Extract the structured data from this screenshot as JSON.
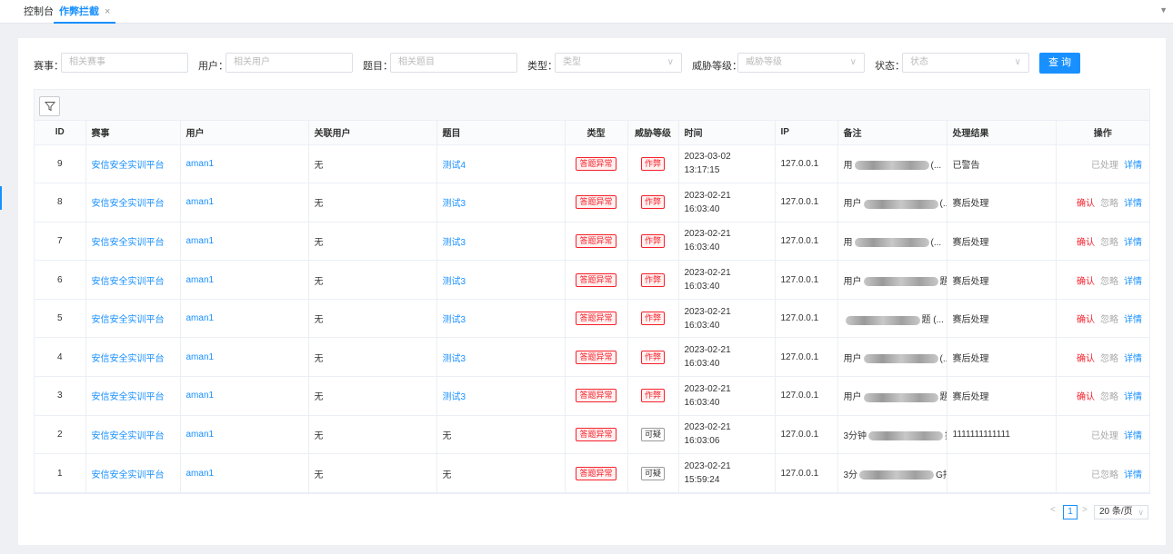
{
  "tabs": {
    "console": "控制台",
    "active": "作弊拦截",
    "close": "×",
    "dropdown": "▼"
  },
  "filters": {
    "event_label": "赛事：",
    "event_placeholder": "相关赛事",
    "user_label": "用户：",
    "user_placeholder": "相关用户",
    "problem_label": "题目：",
    "problem_placeholder": "相关题目",
    "type_label": "类型：",
    "type_placeholder": "类型",
    "threat_label": "威胁等级：",
    "threat_placeholder": "威胁等级",
    "status_label": "状态：",
    "status_placeholder": "状态",
    "query_button": "查 询"
  },
  "table": {
    "headers": {
      "id": "ID",
      "event": "赛事",
      "user": "用户",
      "related_user": "关联用户",
      "problem": "题目",
      "type": "类型",
      "threat": "威胁等级",
      "time": "时间",
      "ip": "IP",
      "remark": "备注",
      "result": "处理结果",
      "ops": "操作"
    },
    "rows": [
      {
        "id": "9",
        "event": "安信安全实训平台",
        "user": "aman1",
        "related": "无",
        "problem": "测试4",
        "problem_link": true,
        "type": "答题异常",
        "threat": "作弊",
        "threat_style": "red",
        "date": "2023-03-02",
        "clock": "13:17:15",
        "ip": "127.0.0.1",
        "remark_pre": "用",
        "remark_post": "(...",
        "result": "已警告",
        "ops": [
          {
            "label": "已处理",
            "style": "gray"
          },
          {
            "label": "详情",
            "style": "blue"
          }
        ]
      },
      {
        "id": "8",
        "event": "安信安全实训平台",
        "user": "aman1",
        "related": "无",
        "problem": "测试3",
        "problem_link": true,
        "type": "答题异常",
        "threat": "作弊",
        "threat_style": "red",
        "date": "2023-02-21",
        "clock": "16:03:40",
        "ip": "127.0.0.1",
        "remark_pre": "用户",
        "remark_post": "(...",
        "result": "赛后处理",
        "ops": [
          {
            "label": "确认",
            "style": "red"
          },
          {
            "label": "忽略",
            "style": "gray"
          },
          {
            "label": "详情",
            "style": "blue"
          }
        ]
      },
      {
        "id": "7",
        "event": "安信安全实训平台",
        "user": "aman1",
        "related": "无",
        "problem": "测试3",
        "problem_link": true,
        "type": "答题异常",
        "threat": "作弊",
        "threat_style": "red",
        "date": "2023-02-21",
        "clock": "16:03:40",
        "ip": "127.0.0.1",
        "remark_pre": "用",
        "remark_post": "(...",
        "result": "赛后处理",
        "ops": [
          {
            "label": "确认",
            "style": "red"
          },
          {
            "label": "忽略",
            "style": "gray"
          },
          {
            "label": "详情",
            "style": "blue"
          }
        ]
      },
      {
        "id": "6",
        "event": "安信安全实训平台",
        "user": "aman1",
        "related": "无",
        "problem": "测试3",
        "problem_link": true,
        "type": "答题异常",
        "threat": "作弊",
        "threat_style": "red",
        "date": "2023-02-21",
        "clock": "16:03:40",
        "ip": "127.0.0.1",
        "remark_pre": "用户",
        "remark_post": "题 (...",
        "result": "赛后处理",
        "ops": [
          {
            "label": "确认",
            "style": "red"
          },
          {
            "label": "忽略",
            "style": "gray"
          },
          {
            "label": "详情",
            "style": "blue"
          }
        ]
      },
      {
        "id": "5",
        "event": "安信安全实训平台",
        "user": "aman1",
        "related": "无",
        "problem": "测试3",
        "problem_link": true,
        "type": "答题异常",
        "threat": "作弊",
        "threat_style": "red",
        "date": "2023-02-21",
        "clock": "16:03:40",
        "ip": "127.0.0.1",
        "remark_pre": "",
        "remark_post": "题 (...",
        "result": "赛后处理",
        "ops": [
          {
            "label": "确认",
            "style": "red"
          },
          {
            "label": "忽略",
            "style": "gray"
          },
          {
            "label": "详情",
            "style": "blue"
          }
        ]
      },
      {
        "id": "4",
        "event": "安信安全实训平台",
        "user": "aman1",
        "related": "无",
        "problem": "测试3",
        "problem_link": true,
        "type": "答题异常",
        "threat": "作弊",
        "threat_style": "red",
        "date": "2023-02-21",
        "clock": "16:03:40",
        "ip": "127.0.0.1",
        "remark_pre": "用户",
        "remark_post": "(...",
        "result": "赛后处理",
        "ops": [
          {
            "label": "确认",
            "style": "red"
          },
          {
            "label": "忽略",
            "style": "gray"
          },
          {
            "label": "详情",
            "style": "blue"
          }
        ]
      },
      {
        "id": "3",
        "event": "安信安全实训平台",
        "user": "aman1",
        "related": "无",
        "problem": "测试3",
        "problem_link": true,
        "type": "答题异常",
        "threat": "作弊",
        "threat_style": "red",
        "date": "2023-02-21",
        "clock": "16:03:40",
        "ip": "127.0.0.1",
        "remark_pre": "用户",
        "remark_post": "题 (...",
        "result": "赛后处理",
        "ops": [
          {
            "label": "确认",
            "style": "red"
          },
          {
            "label": "忽略",
            "style": "gray"
          },
          {
            "label": "详情",
            "style": "blue"
          }
        ]
      },
      {
        "id": "2",
        "event": "安信安全实训平台",
        "user": "aman1",
        "related": "无",
        "problem": "无",
        "problem_link": false,
        "type": "答题异常",
        "threat": "可疑",
        "threat_style": "dark",
        "date": "2023-02-21",
        "clock": "16:03:06",
        "ip": "127.0.0.1",
        "remark_pre": "3分钟",
        "remark_post": "提交错...",
        "result": "1111111111111",
        "ops": [
          {
            "label": "已处理",
            "style": "gray"
          },
          {
            "label": "详情",
            "style": "blue"
          }
        ]
      },
      {
        "id": "1",
        "event": "安信安全实训平台",
        "user": "aman1",
        "related": "无",
        "problem": "无",
        "problem_link": false,
        "type": "答题异常",
        "threat": "可疑",
        "threat_style": "dark",
        "date": "2023-02-21",
        "clock": "15:59:24",
        "ip": "127.0.0.1",
        "remark_pre": "3分",
        "remark_post": "G拒...",
        "result": "",
        "ops": [
          {
            "label": "已忽略",
            "style": "gray"
          },
          {
            "label": "详情",
            "style": "blue"
          }
        ]
      }
    ]
  },
  "pagination": {
    "prev": "<",
    "current": "1",
    "next": ">",
    "page_size": "20 条/页",
    "chevron": "∨"
  },
  "icons": {
    "filter": "filter-icon",
    "close": "close-icon"
  },
  "colors": {
    "primary": "#1890ff",
    "danger": "#f5222d"
  }
}
